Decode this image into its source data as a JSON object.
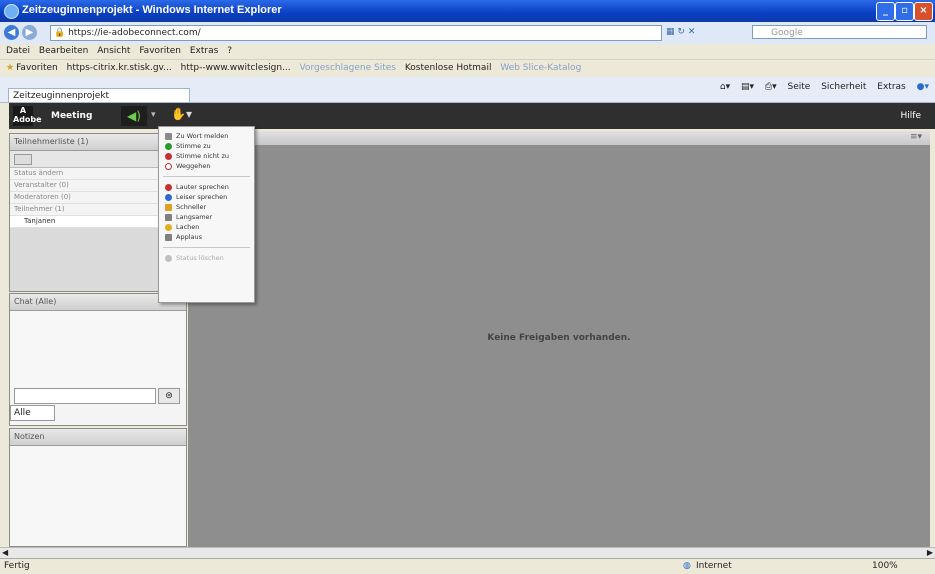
{
  "window": {
    "title": "Zeitzeuginnenprojekt - Windows Internet Explorer"
  },
  "address": {
    "url": "https://ie-adobeconnect.com/"
  },
  "search": {
    "placeholder": "Google"
  },
  "menubar": {
    "items": [
      "Datei",
      "Bearbeiten",
      "Ansicht",
      "Favoriten",
      "Extras",
      "?"
    ]
  },
  "favorites": {
    "items": [
      "Favoriten",
      "https-citrix.kr.stisk.gv...",
      "http--www.wwitclesign...",
      "Vorgeschlagene Sites",
      "Kostenlose Hotmail",
      "Web Slice-Katalog"
    ]
  },
  "tab": {
    "label": "Zeitzeuginnenprojekt"
  },
  "ie_tools": {
    "seite": "Seite",
    "sicherheit": "Sicherheit",
    "extras": "Extras"
  },
  "app": {
    "meeting": "Meeting",
    "hilfe": "Hilfe"
  },
  "participants": {
    "title": "Teilnehmerliste (1)",
    "rows": [
      {
        "label": "Status ändern"
      },
      {
        "label": "Veranstalter (0)"
      },
      {
        "label": "Moderatoren (0)"
      },
      {
        "label": "Teilnehmer (1)"
      },
      {
        "label": "Tanjanen"
      }
    ]
  },
  "chat": {
    "title": "Chat (Alle)",
    "scope": "Alle"
  },
  "notes": {
    "title": "Notizen"
  },
  "main": {
    "empty_text": "Keine Freigaben vorhanden."
  },
  "dropdown": {
    "items": [
      {
        "label": "Zu Wort melden",
        "icon": "hand-icon",
        "color": "#7a7a7a"
      },
      {
        "label": "Stimme zu",
        "icon": "agree-icon",
        "color": "#2a9a2a"
      },
      {
        "label": "Stimme nicht zu",
        "icon": "disagree-icon",
        "color": "#c83030"
      },
      {
        "label": "Weggehen",
        "icon": "away-icon",
        "color": "#c83030"
      },
      {
        "label": "Lauter sprechen",
        "icon": "louder-icon",
        "color": "#c83030"
      },
      {
        "label": "Leiser sprechen",
        "icon": "softer-icon",
        "color": "#2a6ac8"
      },
      {
        "label": "Schneller",
        "icon": "faster-icon",
        "color": "#e0a020"
      },
      {
        "label": "Langsamer",
        "icon": "slower-icon",
        "color": "#808080"
      },
      {
        "label": "Lachen",
        "icon": "laugh-icon",
        "color": "#e0b020"
      },
      {
        "label": "Applaus",
        "icon": "applause-icon",
        "color": "#808080"
      },
      {
        "label": "Status löschen",
        "icon": "clear-icon",
        "color": "#c0c0c0"
      }
    ]
  },
  "statusbar": {
    "left": "Fertig",
    "zone": "Internet",
    "zoom": "100%"
  }
}
